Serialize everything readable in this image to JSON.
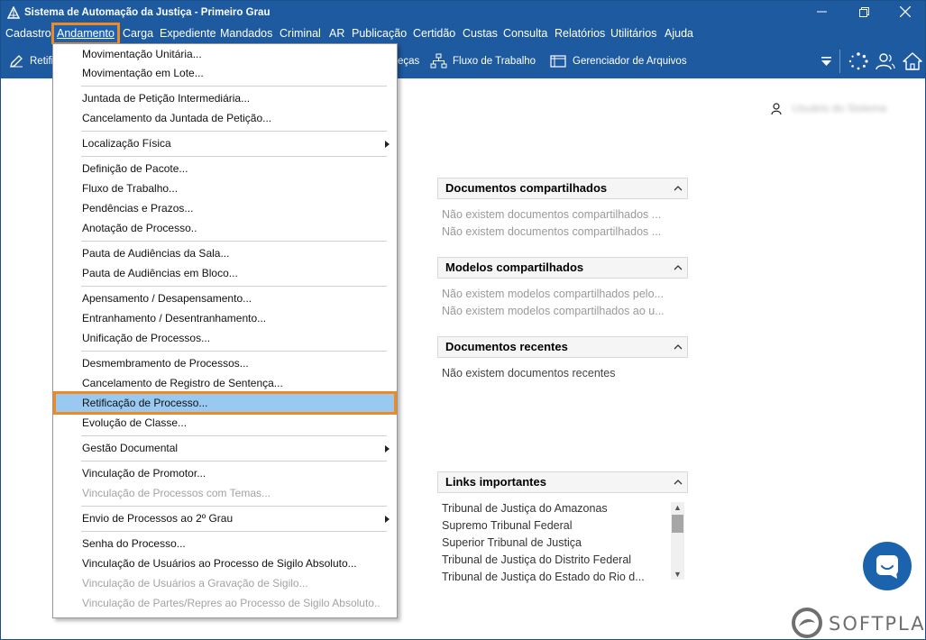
{
  "window": {
    "title": "Sistema de Automação da Justiça - Primeiro Grau"
  },
  "menubar": {
    "items": [
      "Cadastro",
      "Andamento",
      "Carga",
      "Expediente",
      "Mandados",
      "Criminal",
      "AR",
      "Publicação",
      "Certidão",
      "Custas",
      "Consulta",
      "Relatórios",
      "Utilitários",
      "Ajuda"
    ],
    "active": "Andamento"
  },
  "toolbar": {
    "partial_left": "Retifi",
    "partial_mid": "eças",
    "fluxo": "Fluxo de Trabalho",
    "gerenciador": "Gerenciador de Arquivos"
  },
  "dropdown": {
    "items": [
      {
        "label": "Movimentação Unitária...",
        "disabled": false,
        "submenu": false
      },
      {
        "label": "Movimentação em Lote...",
        "disabled": false,
        "submenu": false
      },
      {
        "label": "Juntada de Petição Intermediária...",
        "disabled": false,
        "submenu": false
      },
      {
        "label": "Cancelamento da Juntada de Petição...",
        "disabled": false,
        "submenu": false
      },
      {
        "label": "Localização Física",
        "disabled": false,
        "submenu": true
      },
      {
        "label": "Definição de Pacote...",
        "disabled": false,
        "submenu": false
      },
      {
        "label": "Fluxo de Trabalho...",
        "disabled": false,
        "submenu": false
      },
      {
        "label": "Pendências e Prazos...",
        "disabled": false,
        "submenu": false
      },
      {
        "label": "Anotação de Processo..",
        "disabled": false,
        "submenu": false
      },
      {
        "label": "Pauta de Audiências da Sala...",
        "disabled": false,
        "submenu": false
      },
      {
        "label": "Pauta de Audiências em Bloco...",
        "disabled": false,
        "submenu": false
      },
      {
        "label": "Apensamento / Desapensamento...",
        "disabled": false,
        "submenu": false
      },
      {
        "label": "Entranhamento / Desentranhamento...",
        "disabled": false,
        "submenu": false
      },
      {
        "label": "Unificação de Processos...",
        "disabled": false,
        "submenu": false
      },
      {
        "label": "Desmembramento de Processos...",
        "disabled": false,
        "submenu": false
      },
      {
        "label": "Cancelamento de Registro de Sentença...",
        "disabled": false,
        "submenu": false
      },
      {
        "label": "Retificação de Processo...",
        "disabled": false,
        "submenu": false,
        "highlighted": true
      },
      {
        "label": "Evolução de Classe...",
        "disabled": false,
        "submenu": false
      },
      {
        "label": "Gestão Documental",
        "disabled": false,
        "submenu": true
      },
      {
        "label": "Vinculação de Promotor...",
        "disabled": false,
        "submenu": false
      },
      {
        "label": "Vinculação de Processos com Temas...",
        "disabled": true,
        "submenu": false
      },
      {
        "label": "Envio de Processos ao 2º Grau",
        "disabled": false,
        "submenu": true
      },
      {
        "label": "Senha do Processo...",
        "disabled": false,
        "submenu": false
      },
      {
        "label": "Vinculação de Usuários ao Processo de Sigilo Absoluto...",
        "disabled": false,
        "submenu": false
      },
      {
        "label": "Vinculação de Usuários a Gravação de Sigilo...",
        "disabled": true,
        "submenu": false
      },
      {
        "label": "Vinculação de Partes/Repres ao Processo de Sigilo Absoluto..",
        "disabled": true,
        "submenu": false
      }
    ]
  },
  "user": {
    "name": "Usuário do Sistema"
  },
  "panels": {
    "docs_compartilhados": {
      "title": "Documentos compartilhados",
      "lines": [
        "Não existem documentos compartilhados ...",
        "Não existem documentos compartilhados ..."
      ]
    },
    "modelos_compartilhados": {
      "title": "Modelos compartilhados",
      "lines": [
        "Não existem modelos compartilhados pelo...",
        "Não existem modelos compartilhados ao u..."
      ]
    },
    "docs_recentes": {
      "title": "Documentos recentes",
      "lines": [
        "Não existem documentos recentes"
      ]
    },
    "links": {
      "title": "Links importantes",
      "items": [
        "Tribunal de Justiça do Amazonas",
        "Supremo Tribunal Federal",
        "Superior Tribunal de Justiça",
        "Tribunal de Justiça do Distrito Federal",
        "Tribunal de Justiça do Estado do Rio d..."
      ]
    }
  },
  "brand": {
    "name": "SOFTPLAN"
  },
  "colors": {
    "header_blue": "#1e5aa0",
    "highlight_orange": "#ef8a22",
    "selection_blue": "#99c9f0",
    "chat_blue": "#1b63ad"
  }
}
